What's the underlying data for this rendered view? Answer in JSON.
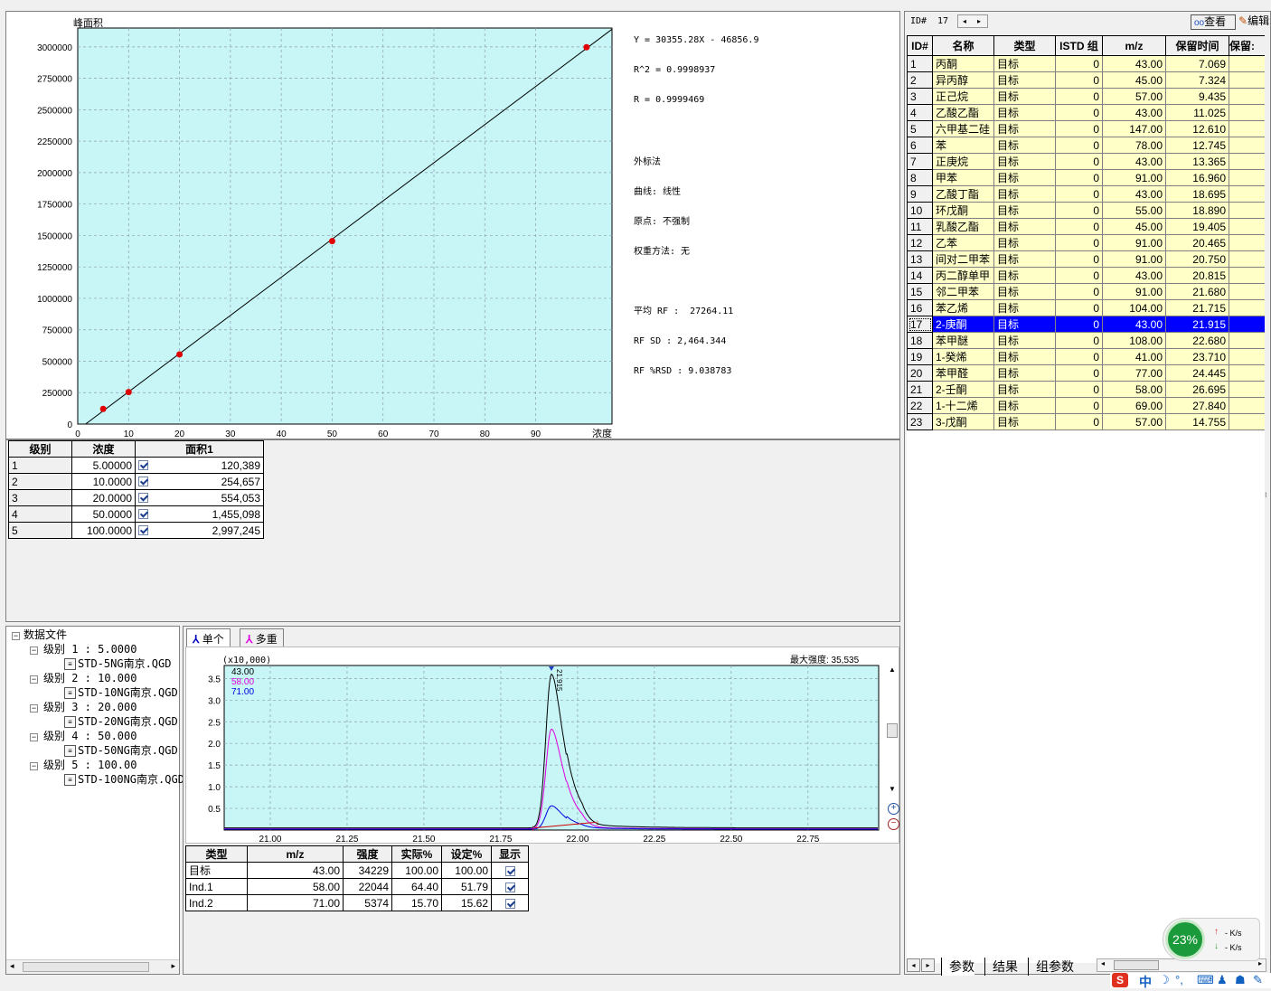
{
  "calibration": {
    "ylabel": "峰面积",
    "xlabel": "浓度",
    "eq_lines": [
      "Y = 30355.28X - 46856.9",
      "R^2 = 0.9998937",
      "R = 0.9999469"
    ],
    "info_lines": [
      "外标法",
      "曲线: 线性",
      "原点: 不强制",
      "权重方法: 无"
    ],
    "rf_lines": [
      "平均 RF :  27264.11",
      "RF SD : 2,464.344",
      "RF %RSD : 9.038783"
    ]
  },
  "level_table": {
    "headers": [
      "级别",
      "浓度",
      "面积1"
    ],
    "rows": [
      {
        "level": "1",
        "conc": "5.00000",
        "area": "120,389"
      },
      {
        "level": "2",
        "conc": "10.0000",
        "area": "254,657"
      },
      {
        "level": "3",
        "conc": "20.0000",
        "area": "554,053"
      },
      {
        "level": "4",
        "conc": "50.0000",
        "area": "1,455,098"
      },
      {
        "level": "5",
        "conc": "100.0000",
        "area": "2,997,245"
      }
    ]
  },
  "tree": {
    "root": "数据文件",
    "levels": [
      {
        "label": "级别 1 : 5.0000",
        "file": "STD-5NG南京.QGD"
      },
      {
        "label": "级别 2 : 10.000",
        "file": "STD-10NG南京.QGD"
      },
      {
        "label": "级别 3 : 20.000",
        "file": "STD-20NG南京.QGD"
      },
      {
        "label": "级别 4 : 50.000",
        "file": "STD-50NG南京.QGD"
      },
      {
        "label": "级别 5 : 100.00",
        "file": "STD-100NG南京.QGD"
      }
    ]
  },
  "chrom_tabs": [
    "单个",
    "多重"
  ],
  "chrom": {
    "scale": "(x10,000)",
    "max_label": "最大强度:  35,535",
    "legend": [
      "43.00",
      "58.00",
      "71.00"
    ],
    "peak_label": "21.915"
  },
  "ion_table": {
    "headers": [
      "类型",
      "m/z",
      "强度",
      "实际%",
      "设定%",
      "显示"
    ],
    "rows": [
      {
        "type": "目标",
        "mz": "43.00",
        "intensity": "34229",
        "actual": "100.00",
        "set": "100.00"
      },
      {
        "type": "Ind.1",
        "mz": "58.00",
        "intensity": "22044",
        "actual": "64.40",
        "set": "51.79"
      },
      {
        "type": "Ind.2",
        "mz": "71.00",
        "intensity": "5374",
        "actual": "15.70",
        "set": "15.62"
      }
    ]
  },
  "right_panel": {
    "id_label": "ID#",
    "id_value": "17",
    "view_btn": "查看",
    "edit_btn": "编辑",
    "headers": [
      "ID#",
      "名称",
      "类型",
      "ISTD 组",
      "m/z",
      "保留时间",
      "保留:"
    ],
    "rows": [
      {
        "id": "1",
        "name": "丙酮",
        "type": "目标",
        "istd": "0",
        "mz": "43.00",
        "rt": "7.069"
      },
      {
        "id": "2",
        "name": "异丙醇",
        "type": "目标",
        "istd": "0",
        "mz": "45.00",
        "rt": "7.324"
      },
      {
        "id": "3",
        "name": "正己烷",
        "type": "目标",
        "istd": "0",
        "mz": "57.00",
        "rt": "9.435"
      },
      {
        "id": "4",
        "name": "乙酸乙酯",
        "type": "目标",
        "istd": "0",
        "mz": "43.00",
        "rt": "11.025"
      },
      {
        "id": "5",
        "name": "六甲基二硅",
        "type": "目标",
        "istd": "0",
        "mz": "147.00",
        "rt": "12.610"
      },
      {
        "id": "6",
        "name": "苯",
        "type": "目标",
        "istd": "0",
        "mz": "78.00",
        "rt": "12.745"
      },
      {
        "id": "7",
        "name": "正庚烷",
        "type": "目标",
        "istd": "0",
        "mz": "43.00",
        "rt": "13.365"
      },
      {
        "id": "8",
        "name": "甲苯",
        "type": "目标",
        "istd": "0",
        "mz": "91.00",
        "rt": "16.960"
      },
      {
        "id": "9",
        "name": "乙酸丁酯",
        "type": "目标",
        "istd": "0",
        "mz": "43.00",
        "rt": "18.695"
      },
      {
        "id": "10",
        "name": "环戊酮",
        "type": "目标",
        "istd": "0",
        "mz": "55.00",
        "rt": "18.890"
      },
      {
        "id": "11",
        "name": "乳酸乙酯",
        "type": "目标",
        "istd": "0",
        "mz": "45.00",
        "rt": "19.405"
      },
      {
        "id": "12",
        "name": "乙苯",
        "type": "目标",
        "istd": "0",
        "mz": "91.00",
        "rt": "20.465"
      },
      {
        "id": "13",
        "name": "间对二甲苯",
        "type": "目标",
        "istd": "0",
        "mz": "91.00",
        "rt": "20.750"
      },
      {
        "id": "14",
        "name": "丙二醇单甲",
        "type": "目标",
        "istd": "0",
        "mz": "43.00",
        "rt": "20.815"
      },
      {
        "id": "15",
        "name": "邻二甲苯",
        "type": "目标",
        "istd": "0",
        "mz": "91.00",
        "rt": "21.680"
      },
      {
        "id": "16",
        "name": "苯乙烯",
        "type": "目标",
        "istd": "0",
        "mz": "104.00",
        "rt": "21.715"
      },
      {
        "id": "17",
        "name": "2-庚酮",
        "type": "目标",
        "istd": "0",
        "mz": "43.00",
        "rt": "21.915",
        "selected": true
      },
      {
        "id": "18",
        "name": "苯甲醚",
        "type": "目标",
        "istd": "0",
        "mz": "108.00",
        "rt": "22.680"
      },
      {
        "id": "19",
        "name": "1-癸烯",
        "type": "目标",
        "istd": "0",
        "mz": "41.00",
        "rt": "23.710"
      },
      {
        "id": "20",
        "name": "苯甲醛",
        "type": "目标",
        "istd": "0",
        "mz": "77.00",
        "rt": "24.445"
      },
      {
        "id": "21",
        "name": "2-壬酮",
        "type": "目标",
        "istd": "0",
        "mz": "58.00",
        "rt": "26.695"
      },
      {
        "id": "22",
        "name": "1-十二烯",
        "type": "目标",
        "istd": "0",
        "mz": "69.00",
        "rt": "27.840"
      },
      {
        "id": "23",
        "name": "3-戊酮",
        "type": "目标",
        "istd": "0",
        "mz": "57.00",
        "rt": "14.755"
      }
    ],
    "bottom_tabs": [
      "参数",
      "结果",
      "组参数"
    ]
  },
  "net_widget": {
    "percent": "23%",
    "up": "- K/s",
    "down": "- K/s"
  },
  "tray": {
    "ime": "中"
  },
  "colors": {
    "plot_bg": "#c8f5f5",
    "point": "#e00000",
    "selected_row": "#0000ff",
    "row_bg": "#ffffc8",
    "ion1": "#000000",
    "ion2": "#e000e0",
    "ion3": "#0000e0"
  },
  "chart_data": [
    {
      "type": "scatter",
      "title": "",
      "xlabel": "浓度",
      "ylabel": "峰面积",
      "xlim": [
        0,
        105
      ],
      "ylim": [
        0,
        3150000
      ],
      "xticks": [
        0,
        10,
        20,
        30,
        40,
        50,
        60,
        70,
        80,
        90
      ],
      "yticks": [
        0,
        250000,
        500000,
        750000,
        1000000,
        1250000,
        1500000,
        1750000,
        2000000,
        2250000,
        2500000,
        2750000,
        3000000
      ],
      "points": [
        [
          5,
          120389
        ],
        [
          10,
          254657
        ],
        [
          20,
          554053
        ],
        [
          50,
          1455098
        ],
        [
          100,
          2997245
        ]
      ],
      "fit_line": {
        "slope": 30355.28,
        "intercept": -46856.9
      },
      "grid": true
    },
    {
      "type": "line",
      "title": "",
      "xlabel": "",
      "ylabel": "",
      "xlim": [
        20.85,
        22.98
      ],
      "ylim": [
        0.0,
        3.8
      ],
      "xticks": [
        "21.00",
        "21.25",
        "21.50",
        "21.75",
        "22.00",
        "22.25",
        "22.50",
        "22.75"
      ],
      "yticks": [
        "0.5",
        "1.0",
        "1.5",
        "2.0",
        "2.5",
        "3.0",
        "3.5"
      ],
      "series": [
        {
          "name": "43.00",
          "peak_rt": 21.915,
          "peak_height": 3.55,
          "baseline": 0.05
        },
        {
          "name": "58.00",
          "peak_rt": 21.915,
          "peak_height": 2.3,
          "baseline": 0.03
        },
        {
          "name": "71.00",
          "peak_rt": 21.915,
          "peak_height": 0.54,
          "baseline": 0.02
        }
      ],
      "grid": true
    }
  ]
}
